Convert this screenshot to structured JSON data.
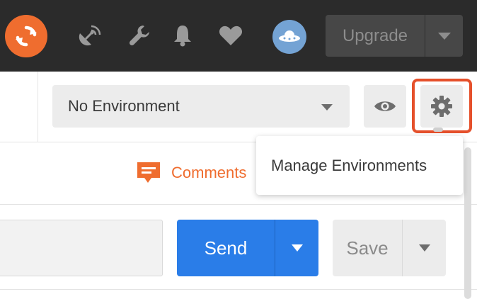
{
  "header": {
    "sync_icon": "sync-icon",
    "icons": [
      "satellite-icon",
      "wrench-icon",
      "bell-icon",
      "heart-icon"
    ],
    "avatar_icon": "ufo-icon",
    "upgrade_label": "Upgrade",
    "colors": {
      "background": "#2b2b2b",
      "sync": "#ef6d2f",
      "avatar": "#74a3d4"
    }
  },
  "environment": {
    "selected": "No Environment",
    "eye_icon": "eye-icon",
    "settings_icon": "gear-icon",
    "highlight_color": "#e5502b"
  },
  "dropdown": {
    "items": [
      {
        "label": "Manage Environments"
      }
    ]
  },
  "comments": {
    "label": "Comments",
    "icon": "comment-icon",
    "color": "#ef6d2f"
  },
  "request": {
    "send_label": "Send",
    "save_label": "Save",
    "send_color": "#2a7de8"
  }
}
